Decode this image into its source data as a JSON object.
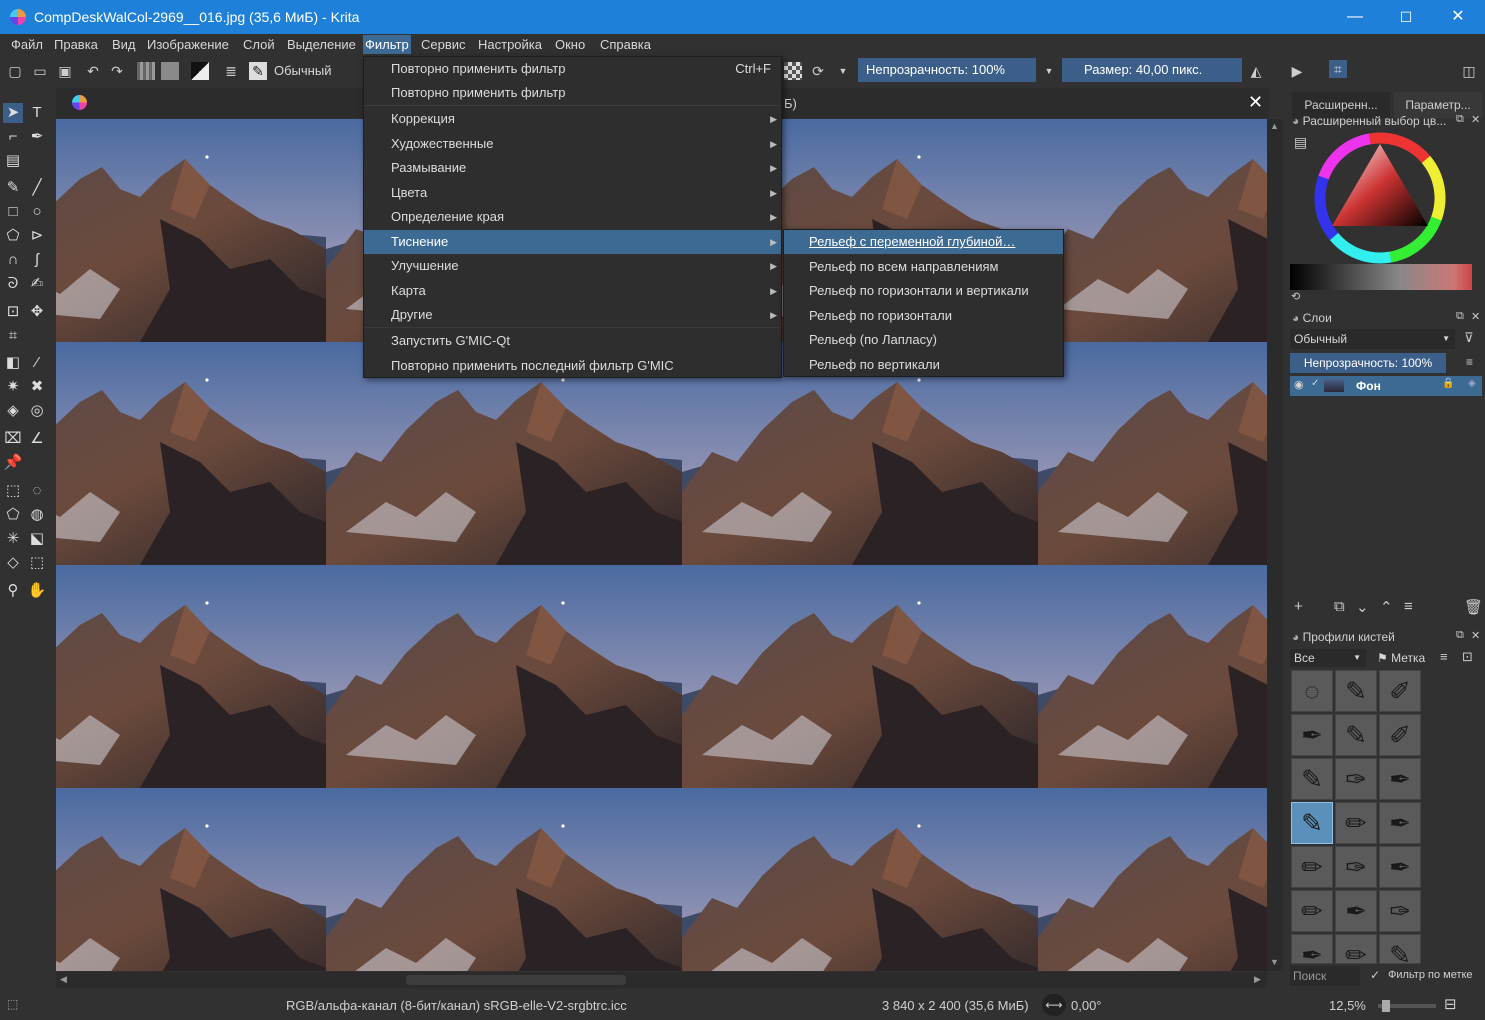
{
  "window": {
    "title": "CompDeskWalCol-2969__016.jpg (35,6 МиБ) - Krita",
    "minimize": "—",
    "maximize": "☐",
    "close": "✕"
  },
  "menubar": [
    "Файл",
    "Правка",
    "Вид",
    "Изображение",
    "Слой",
    "Выделение",
    "Фильтр",
    "Сервис",
    "Настройка",
    "Окно",
    "Справка"
  ],
  "toolbar": {
    "blend_mode": "Обычный",
    "opacity": "Непрозрачность: 100%",
    "size": "Размер: 40,00 пикс."
  },
  "document_tab": {
    "title_fragment": "Б)",
    "close": "✕"
  },
  "filter_menu": {
    "items": [
      {
        "label": "Повторно применить фильтр",
        "shortcut": "Ctrl+F",
        "submenu": false
      },
      {
        "label": "Повторно применить фильтр",
        "shortcut": "",
        "submenu": false
      },
      {
        "label": "Коррекция",
        "shortcut": "",
        "submenu": true
      },
      {
        "label": "Художественные",
        "shortcut": "",
        "submenu": true
      },
      {
        "label": "Размывание",
        "shortcut": "",
        "submenu": true
      },
      {
        "label": "Цвета",
        "shortcut": "",
        "submenu": true
      },
      {
        "label": "Определение края",
        "shortcut": "",
        "submenu": true
      },
      {
        "label": "Тиснение",
        "shortcut": "",
        "submenu": true
      },
      {
        "label": "Улучшение",
        "shortcut": "",
        "submenu": true
      },
      {
        "label": "Карта",
        "shortcut": "",
        "submenu": true
      },
      {
        "label": "Другие",
        "shortcut": "",
        "submenu": true
      },
      {
        "label": "Запустить G'MIC-Qt",
        "shortcut": "",
        "submenu": false
      },
      {
        "label": "Повторно применить последний фильтр G'MIC",
        "shortcut": "",
        "submenu": false
      }
    ],
    "highlighted": "Тиснение"
  },
  "emboss_submenu": {
    "items": [
      "Рельеф с переменной глубиной…",
      "Рельеф по всем направлениям",
      "Рельеф по горизонтали и вертикали",
      "Рельеф по горизонтали",
      "Рельеф (по Лапласу)",
      "Рельеф по вертикали"
    ],
    "highlighted": "Рельеф с переменной глубиной…"
  },
  "dock": {
    "tabs": [
      "Расширенн...",
      "Параметр..."
    ],
    "color_selector_title": "Расширенный выбор цв...",
    "layers_title": "Слои",
    "layer_blend": "Обычный",
    "layer_opacity": "Непрозрачность: 100%",
    "layer_name": "Фон",
    "brush_presets_title": "Профили кистей",
    "brush_filter": "Все",
    "brush_tag": "Метка",
    "search_placeholder": "Поиск",
    "filter_by_tag": "Фильтр по метке"
  },
  "statusbar": {
    "color_space": "RGB/альфа-канал (8-бит/канал)  sRGB-elle-V2-srgbtrc.icc",
    "dimensions": "3 840 x 2 400 (35,6 МиБ)",
    "rotation": "0,00°",
    "zoom": "12,5%"
  },
  "colors": {
    "titlebar": "#1e80d8",
    "highlight": "#3d6a93",
    "background": "#313131"
  }
}
